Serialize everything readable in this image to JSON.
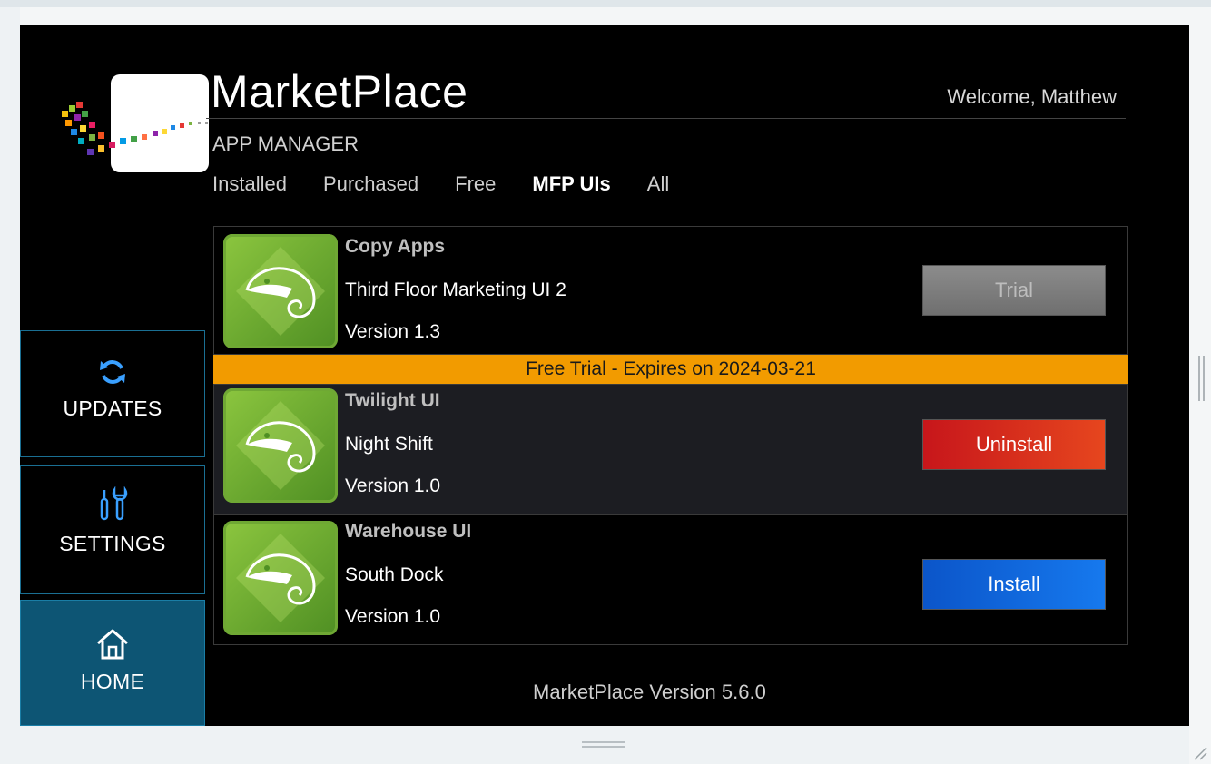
{
  "header": {
    "title": "MarketPlace",
    "subtitle": "APP MANAGER",
    "welcome": "Welcome, Matthew"
  },
  "filters": [
    {
      "label": "Installed",
      "active": false
    },
    {
      "label": "Purchased",
      "active": false
    },
    {
      "label": "Free",
      "active": false
    },
    {
      "label": "MFP UIs",
      "active": true
    },
    {
      "label": "All",
      "active": false
    }
  ],
  "sidebar": {
    "items": [
      {
        "label": "UPDATES",
        "icon": "refresh-icon"
      },
      {
        "label": "SETTINGS",
        "icon": "tools-icon"
      },
      {
        "label": "HOME",
        "icon": "home-icon",
        "active": true
      }
    ]
  },
  "apps": [
    {
      "category": "Copy Apps",
      "name": "Third Floor Marketing UI 2",
      "version": "Version 1.3",
      "action": "Trial",
      "icon": "chameleon-icon"
    },
    {
      "category": "Twilight UI",
      "name": "Night Shift",
      "version": "Version 1.0",
      "action": "Uninstall",
      "icon": "chameleon-icon"
    },
    {
      "category": "Warehouse UI",
      "name": "South Dock",
      "version": "Version 1.0",
      "action": "Install",
      "icon": "chameleon-icon"
    }
  ],
  "trial_banner": "Free Trial - Expires on 2024-03-21",
  "footer": {
    "version": "MarketPlace Version 5.6.0"
  },
  "colors": {
    "accent_sidebar": "#0d5574",
    "banner": "#f29b00",
    "uninstall": "#d32a1c",
    "install": "#0f66de",
    "trial": "#7d7d7d"
  }
}
